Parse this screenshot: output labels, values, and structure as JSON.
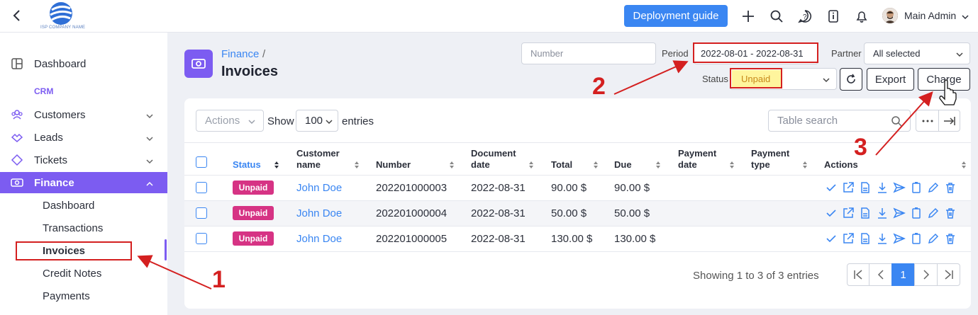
{
  "topbar": {
    "logo_text": "ISP COMPANY NAME",
    "deploy_label": "Deployment guide",
    "admin_name": "Main Admin",
    "icons": [
      "back-icon",
      "plus-icon",
      "search-icon",
      "help-icon",
      "info-icon",
      "bell-icon",
      "avatar",
      "chevron-down-icon"
    ]
  },
  "sidebar": {
    "items": [
      {
        "label": "Dashboard",
        "icon": "dashboard-icon"
      },
      {
        "label": "Customers",
        "icon": "customers-icon"
      },
      {
        "label": "Leads",
        "icon": "leads-icon"
      },
      {
        "label": "Tickets",
        "icon": "tickets-icon"
      },
      {
        "label": "Finance",
        "icon": "finance-icon"
      }
    ],
    "section_crm": "CRM",
    "finance_sub": [
      "Dashboard",
      "Transactions",
      "Invoices",
      "Credit Notes",
      "Payments"
    ]
  },
  "page": {
    "breadcrumb": "Finance",
    "breadcrumb_sep": "/",
    "title": "Invoices"
  },
  "filters": {
    "number_placeholder": "Number",
    "period_label": "Period",
    "period_value": "2022-08-01 - 2022-08-31",
    "partner_label": "Partner",
    "partner_value": "All selected",
    "status_label": "Status",
    "status_value": "Unpaid",
    "export_label": "Export",
    "charge_label": "Charge"
  },
  "table_controls": {
    "actions_label": "Actions",
    "show_label": "Show",
    "entries_value": "100",
    "entries_label": "entries",
    "search_placeholder": "Table search"
  },
  "columns": [
    "Status",
    "Customer name",
    "Number",
    "Document date",
    "Total",
    "Due",
    "Payment date",
    "Payment type",
    "Actions"
  ],
  "column_lines": {
    "customer": [
      "Customer",
      "name"
    ],
    "document": [
      "Document",
      "date"
    ],
    "payment_date": [
      "Payment",
      "date"
    ],
    "payment_type": [
      "Payment",
      "type"
    ]
  },
  "rows": [
    {
      "status": "Unpaid",
      "customer": "John Doe",
      "number": "202201000003",
      "date": "2022-08-31",
      "total": "90.00 $",
      "due": "90.00 $"
    },
    {
      "status": "Unpaid",
      "customer": "John Doe",
      "number": "202201000004",
      "date": "2022-08-31",
      "total": "50.00 $",
      "due": "50.00 $"
    },
    {
      "status": "Unpaid",
      "customer": "John Doe",
      "number": "202201000005",
      "date": "2022-08-31",
      "total": "130.00 $",
      "due": "130.00 $"
    }
  ],
  "footer": {
    "showing": "Showing 1 to 3 of 3 entries",
    "current_page": "1"
  },
  "annotations": [
    "1",
    "2",
    "3"
  ],
  "colors": {
    "accent": "#7c5cf1",
    "primary": "#3a86f2",
    "badge_unpaid": "#d63384",
    "annotation_red": "#d42020",
    "status_highlight": "#fff59d"
  }
}
